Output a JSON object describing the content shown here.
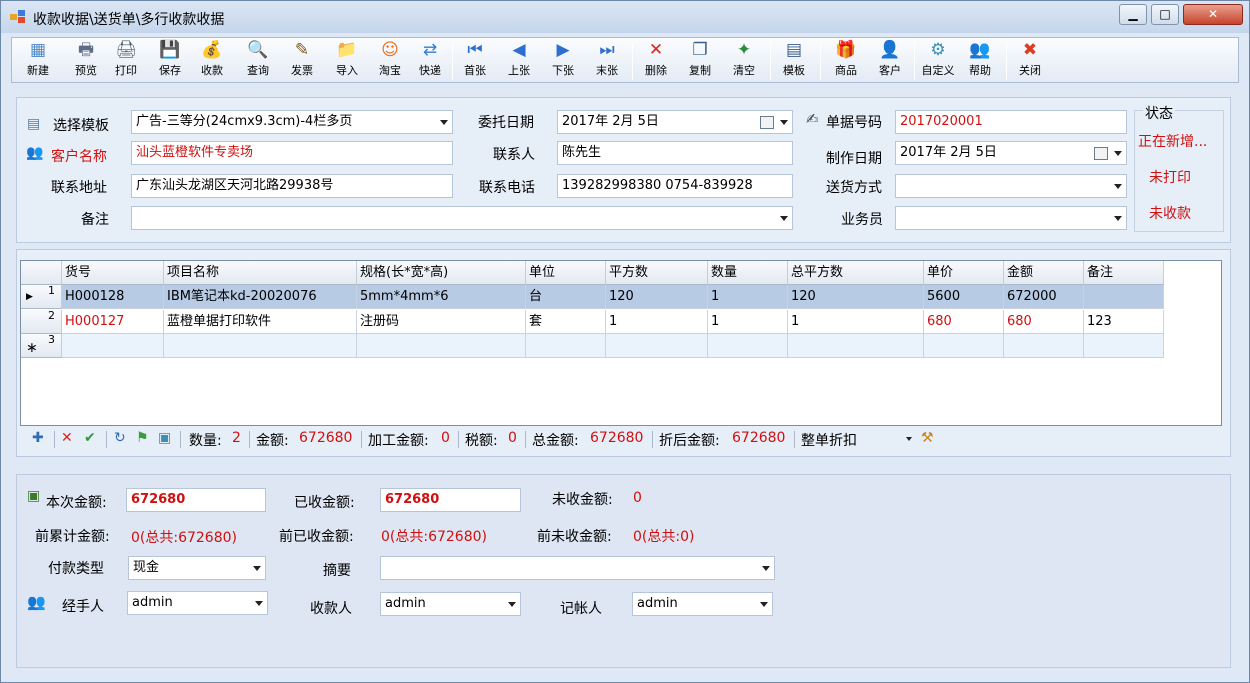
{
  "window": {
    "title": "收款收据\\送货单\\多行收款收据"
  },
  "toolbar": {
    "buttons": [
      {
        "label": "新建",
        "icon": "new-icon",
        "glyph": "▦"
      },
      {
        "label": "预览",
        "icon": "preview-icon",
        "glyph": "🖶"
      },
      {
        "label": "打印",
        "icon": "print-icon",
        "glyph": "🖨"
      },
      {
        "label": "保存",
        "icon": "save-icon",
        "glyph": "💾"
      },
      {
        "label": "收款",
        "icon": "receipt-icon",
        "glyph": "💰"
      },
      {
        "label": "查询",
        "icon": "search-icon",
        "glyph": "🔍"
      },
      {
        "label": "发票",
        "icon": "invoice-icon",
        "glyph": "✎"
      },
      {
        "label": "导入",
        "icon": "import-icon",
        "glyph": "📁"
      },
      {
        "label": "淘宝",
        "icon": "taobao-icon",
        "glyph": "☺"
      },
      {
        "label": "快递",
        "icon": "express-icon",
        "glyph": "⇄"
      },
      {
        "label": "首张",
        "icon": "first-icon",
        "glyph": "⏮"
      },
      {
        "label": "上张",
        "icon": "prev-icon",
        "glyph": "◀"
      },
      {
        "label": "下张",
        "icon": "next-icon",
        "glyph": "▶"
      },
      {
        "label": "末张",
        "icon": "last-icon",
        "glyph": "⏭"
      },
      {
        "label": "删除",
        "icon": "delete-icon",
        "glyph": "✕"
      },
      {
        "label": "复制",
        "icon": "copy-icon",
        "glyph": "❐"
      },
      {
        "label": "清空",
        "icon": "clear-icon",
        "glyph": "✦"
      },
      {
        "label": "模板",
        "icon": "template-icon",
        "glyph": "▤"
      },
      {
        "label": "商品",
        "icon": "goods-icon",
        "glyph": "🎁"
      },
      {
        "label": "客户",
        "icon": "customer-icon",
        "glyph": "👤"
      },
      {
        "label": "自定义",
        "icon": "custom-icon",
        "glyph": "⚙"
      },
      {
        "label": "帮助",
        "icon": "help-icon",
        "glyph": "👥"
      },
      {
        "label": "关闭",
        "icon": "close-icon",
        "glyph": "✖"
      }
    ]
  },
  "header_form": {
    "template_label": "选择模板",
    "template_value": "广告-三等分(24cmx9.3cm)-4栏多页",
    "customer_label": "客户名称",
    "customer_value": "汕头蓝橙软件专卖场",
    "address_label": "联系地址",
    "address_value": "广东汕头龙湖区天河北路29938号",
    "note_label": "备注",
    "note_value": "",
    "entrust_date_label": "委托日期",
    "entrust_date_value": "2017年 2月 5日",
    "contact_label": "联系人",
    "contact_value": "陈先生",
    "phone_label": "联系电话",
    "phone_value": "139282998380 0754-839928",
    "doc_no_label": "单据号码",
    "doc_no_value": "2017020001",
    "make_date_label": "制作日期",
    "make_date_value": "2017年 2月 5日",
    "delivery_label": "送货方式",
    "delivery_value": "",
    "salesman_label": "业务员",
    "salesman_value": "",
    "status_title": "状态",
    "status_new": "正在新增...",
    "status_print": "未打印",
    "status_paid": "未收款"
  },
  "grid": {
    "columns": [
      "货号",
      "项目名称",
      "规格(长*宽*高)",
      "单位",
      "平方数",
      "数量",
      "总平方数",
      "单价",
      "金额",
      "备注"
    ],
    "rows": [
      {
        "num": "1",
        "cells": [
          "H000128",
          "IBM笔记本kd-20020076",
          "5mm*4mm*6",
          "台",
          "120",
          "1",
          "120",
          "5600",
          "672000",
          ""
        ]
      },
      {
        "num": "2",
        "cells": [
          "H000127",
          "蓝橙单据打印软件",
          "注册码",
          "套",
          "1",
          "1",
          "1",
          "680",
          "680",
          "123"
        ]
      },
      {
        "num": "3",
        "cells": [
          "",
          "",
          "",
          "",
          "",
          "",
          "",
          "",
          "",
          ""
        ]
      }
    ]
  },
  "summary_bar": {
    "qty_label": "数量:",
    "qty_value": "2",
    "amount_label": "金额:",
    "amount_value": "672680",
    "process_label": "加工金额:",
    "process_value": "0",
    "tax_label": "税额:",
    "tax_value": "0",
    "total_label": "总金额:",
    "total_value": "672680",
    "discounted_label": "折后金额:",
    "discounted_value": "672680",
    "whole_discount_label": "整单折扣"
  },
  "payment": {
    "this_amount_label": "本次金额:",
    "this_amount_value": "672680",
    "received_label": "已收金额:",
    "received_value": "672680",
    "unreceived_label": "未收金额:",
    "unreceived_value": "0",
    "prev_total_label": "前累计金额:",
    "prev_total_value": "0(总共:672680)",
    "prev_received_label": "前已收金额:",
    "prev_received_value": "0(总共:672680)",
    "prev_unreceived_label": "前未收金额:",
    "prev_unreceived_value": "0(总共:0)",
    "pay_type_label": "付款类型",
    "pay_type_value": "现金",
    "summary_label": "摘要",
    "summary_value": "",
    "handler_label": "经手人",
    "handler_value": "admin",
    "collector_label": "收款人",
    "collector_value": "admin",
    "bookkeeper_label": "记帐人",
    "bookkeeper_value": "admin"
  }
}
